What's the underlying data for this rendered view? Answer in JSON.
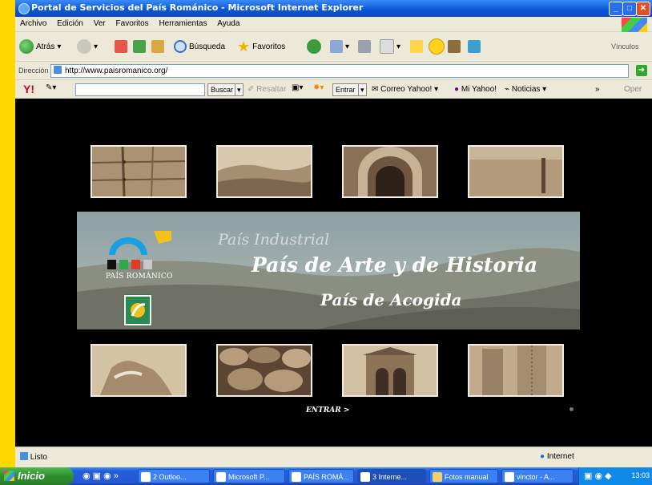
{
  "window": {
    "title": "Portal de Servicios del País Románico - Microsoft Internet Explorer"
  },
  "menubar": {
    "items": [
      "Archivo",
      "Edición",
      "Ver",
      "Favoritos",
      "Herramientas",
      "Ayuda"
    ]
  },
  "toolbar": {
    "back_label": "Atrás",
    "search_label": "Búsqueda",
    "favorites_label": "Favoritos",
    "links_label": "Vínculos"
  },
  "address": {
    "label": "Dirección",
    "url": "http://www.paisromanico.org/"
  },
  "yahoo": {
    "buscar": "Buscar",
    "resaltar": "Resaltar",
    "entrar": "Entrar",
    "correo": "Correo Yahoo!",
    "miyahoo": "Mi Yahoo!",
    "noticias": "Noticias",
    "open": "Oper"
  },
  "page": {
    "logo_text": "PAÍS ROMÁNICO",
    "tagline_1": "País Industrial",
    "tagline_2": "País de Arte y de Historia",
    "tagline_3": "País de Acogida",
    "enter_link": "ENTRAR >"
  },
  "status": {
    "left": "Listo",
    "zone": "Internet"
  },
  "taskbar": {
    "start": "Inicio",
    "buttons": [
      "2 Outloo...",
      "Microsoft P...",
      "PAÍS ROMÁ...",
      "3 Interne...",
      "Fotos manual",
      "vinctor - A..."
    ],
    "clock": "13:03"
  },
  "colors": {
    "sepia_light": "#d8c8ae",
    "sepia_dark": "#7a6248",
    "xp_blue": "#245edb",
    "background": "#000000"
  }
}
